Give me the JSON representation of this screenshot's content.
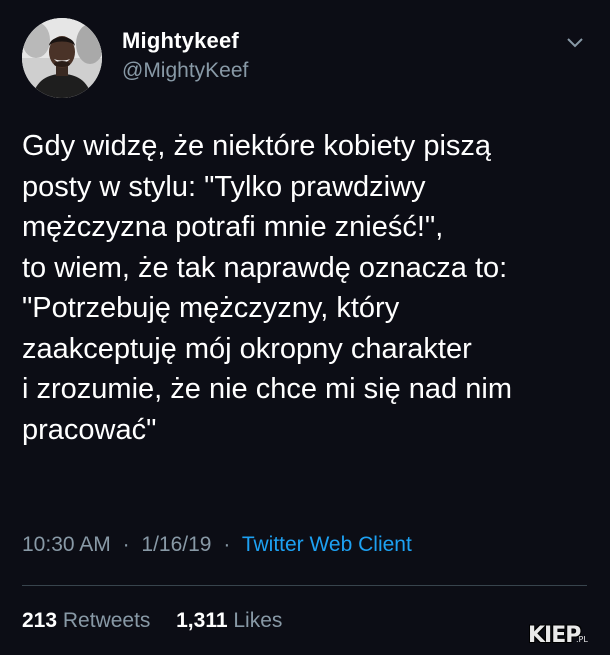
{
  "author": {
    "name": "Mightykeef",
    "handle": "@MightyKeef",
    "avatar_icon": "profile-photo"
  },
  "menu": {
    "icon": "chevron-down-icon"
  },
  "tweet": {
    "lines": [
      "Gdy widzę, że niektóre kobiety piszą",
      "posty w stylu: \"Tylko prawdziwy",
      "mężczyzna potrafi mnie znieść!\",",
      "to wiem, że tak naprawdę oznacza to:",
      "\"Potrzebuję mężczyzny, który",
      "zaakceptuję mój okropny charakter",
      "i zrozumie, że nie chce mi się nad nim",
      "pracować\""
    ]
  },
  "meta": {
    "time": "10:30 AM",
    "separator": "·",
    "date": "1/16/19",
    "source": "Twitter Web Client"
  },
  "stats": {
    "retweets_count": "213",
    "retweets_label": "Retweets",
    "likes_count": "1,311",
    "likes_label": "Likes"
  },
  "watermark": {
    "main": "KIEP",
    "sub": ".PL"
  },
  "colors": {
    "background": "#0c0d15",
    "text": "#ffffff",
    "muted": "#8899a6",
    "link": "#1da1f2",
    "divider": "#38444d"
  }
}
